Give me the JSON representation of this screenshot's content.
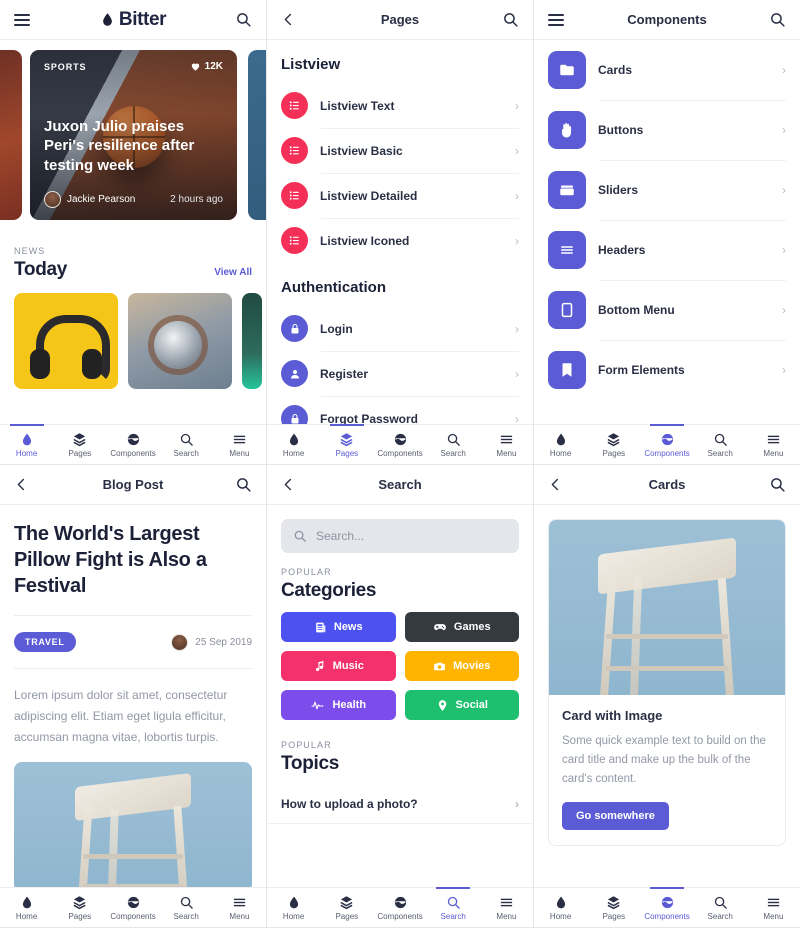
{
  "brand": {
    "name": "Bitter"
  },
  "nav": {
    "items": [
      {
        "label": "Home",
        "icon": "droplet-icon"
      },
      {
        "label": "Pages",
        "icon": "layers-icon"
      },
      {
        "label": "Components",
        "icon": "components-icon"
      },
      {
        "label": "Search",
        "icon": "search-icon"
      },
      {
        "label": "Menu",
        "icon": "menu-icon"
      }
    ]
  },
  "colors": {
    "accent": "#5b5bd6",
    "red": "#f43058",
    "dark": "#343a40",
    "pink": "#f4316a",
    "amber": "#ffb400",
    "purple": "#7c4deb",
    "green": "#1fbf70",
    "text": "#2b2f45",
    "muted": "#9298a6"
  },
  "panel_home": {
    "header": {
      "title": "Bitter",
      "left_icon": "hamburger-icon",
      "right_icon": "search-icon"
    },
    "featured": {
      "category": "SPORTS",
      "likes": "12K",
      "like_icon": "heart-icon",
      "title": "Juxon Julio praises Peri's resilience after testing week",
      "author": "Jackie Pearson",
      "time": "2 hours ago"
    },
    "section": {
      "kicker": "NEWS",
      "title": "Today",
      "link": "View All"
    },
    "active_tab": "Home"
  },
  "panel_pages": {
    "header": {
      "title": "Pages",
      "left_icon": "back-chevron-icon",
      "right_icon": "search-icon"
    },
    "groups": [
      {
        "title": "Listview",
        "items": [
          {
            "label": "Listview Text",
            "icon": "list-icon",
            "color": "red"
          },
          {
            "label": "Listview Basic",
            "icon": "list-icon",
            "color": "red"
          },
          {
            "label": "Listview Detailed",
            "icon": "list-icon",
            "color": "red"
          },
          {
            "label": "Listview Iconed",
            "icon": "list-icon",
            "color": "red"
          }
        ]
      },
      {
        "title": "Authentication",
        "items": [
          {
            "label": "Login",
            "icon": "lock-icon",
            "color": "indigo"
          },
          {
            "label": "Register",
            "icon": "user-icon",
            "color": "indigo"
          },
          {
            "label": "Forgot Password",
            "icon": "lock-icon",
            "color": "indigo"
          }
        ]
      }
    ],
    "active_tab": "Pages"
  },
  "panel_components": {
    "header": {
      "title": "Components",
      "left_icon": "hamburger-icon",
      "right_icon": "search-icon"
    },
    "items": [
      {
        "label": "Cards",
        "icon": "folder-icon"
      },
      {
        "label": "Buttons",
        "icon": "hand-icon"
      },
      {
        "label": "Sliders",
        "icon": "box-icon"
      },
      {
        "label": "Headers",
        "icon": "lines-icon"
      },
      {
        "label": "Bottom Menu",
        "icon": "tablet-icon"
      },
      {
        "label": "Form Elements",
        "icon": "bookmark-icon"
      }
    ],
    "active_tab": "Components"
  },
  "panel_blog": {
    "header": {
      "title": "Blog Post",
      "left_icon": "back-chevron-icon",
      "right_icon": "search-icon"
    },
    "title": "The World's Largest Pillow Fight is Also a Festival",
    "badge": "TRAVEL",
    "date": "25 Sep 2019",
    "body": "Lorem ipsum dolor sit amet, consectetur adipiscing elit. Etiam eget ligula efficitur, accumsan magna vitae, lobortis turpis.",
    "active_tab": "Home"
  },
  "panel_search": {
    "header": {
      "title": "Search",
      "left_icon": "back-chevron-icon"
    },
    "search": {
      "placeholder": "Search...",
      "value": "",
      "icon": "search-icon"
    },
    "categories_section": {
      "kicker": "POPULAR",
      "title": "Categories"
    },
    "categories": [
      {
        "label": "News",
        "icon": "newspaper-icon",
        "color": "#4d51f0"
      },
      {
        "label": "Games",
        "icon": "gamepad-icon",
        "color": "#343a40"
      },
      {
        "label": "Music",
        "icon": "music-note-icon",
        "color": "#f4316a"
      },
      {
        "label": "Movies",
        "icon": "camera-icon",
        "color": "#ffb400"
      },
      {
        "label": "Health",
        "icon": "pulse-icon",
        "color": "#7c4deb"
      },
      {
        "label": "Social",
        "icon": "location-pin-icon",
        "color": "#1fbf70"
      }
    ],
    "topics_section": {
      "kicker": "POPULAR",
      "title": "Topics"
    },
    "topics": [
      {
        "label": "How to upload a photo?"
      }
    ],
    "active_tab": "Search"
  },
  "panel_cards": {
    "header": {
      "title": "Cards",
      "left_icon": "back-chevron-icon",
      "right_icon": "search-icon"
    },
    "card": {
      "title": "Card with Image",
      "text": "Some quick example text to build on the card title and make up the bulk of the card's content.",
      "button": "Go somewhere"
    },
    "active_tab": "Components"
  }
}
